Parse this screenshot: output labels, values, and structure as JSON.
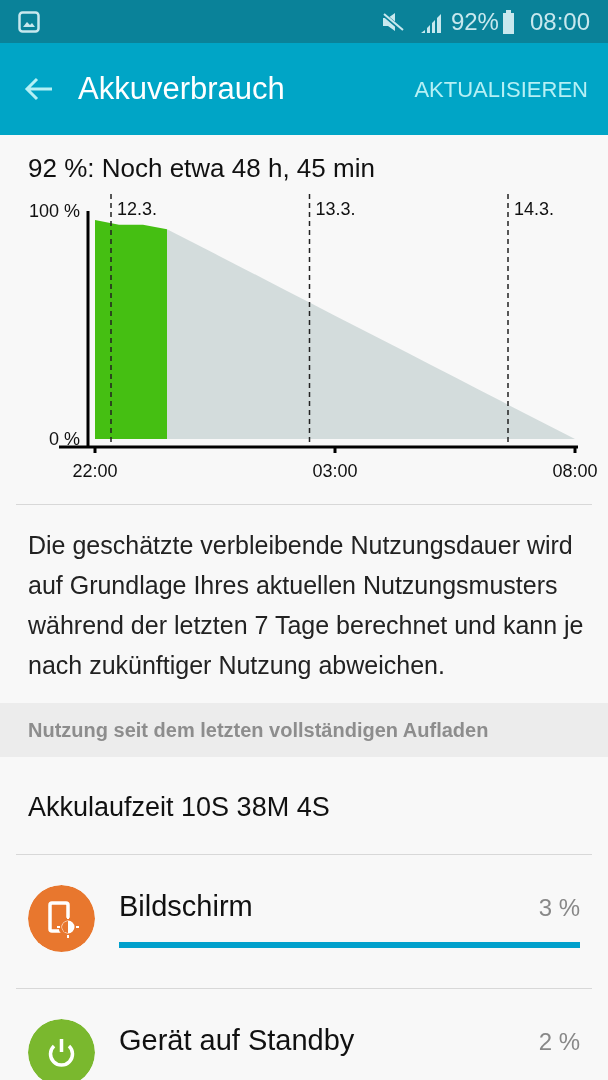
{
  "status_bar": {
    "battery": "92%",
    "time": "08:00"
  },
  "app_bar": {
    "title": "Akkuverbrauch",
    "action": "AKTUALISIEREN"
  },
  "summary": "92 %: Noch etwa 48 h, 45 min",
  "chart_data": {
    "type": "area",
    "categories": [
      "22:00",
      null,
      null,
      null,
      null,
      null,
      null,
      null,
      null,
      null,
      "03:00",
      null,
      null,
      null,
      null,
      null,
      null,
      null,
      null,
      null,
      "08:00"
    ],
    "series": [
      {
        "color": "#45bf12",
        "values": [
          96,
          94,
          94,
          92,
          null,
          null,
          null,
          null,
          null,
          null,
          null,
          null,
          null,
          null,
          null,
          null,
          null,
          null,
          null,
          null,
          null
        ]
      },
      {
        "color": "#d3dcdc",
        "values": [
          null,
          null,
          null,
          92,
          86.6,
          81.2,
          75.8,
          70.4,
          64.9,
          59.5,
          54.1,
          48.7,
          43.3,
          37.9,
          32.5,
          27.1,
          21.6,
          16.2,
          10.8,
          5.4,
          0
        ]
      }
    ],
    "ylim": [
      0,
      100
    ],
    "yticks": [
      {
        "value": 0,
        "label": "0 %"
      },
      {
        "value": 100,
        "label": "100 %"
      }
    ],
    "annotations": [
      "12.3.",
      "13.3.",
      "14.3."
    ]
  },
  "description": "Die geschätzte verbleibende Nutzungsdauer wird auf Grundlage Ihres aktuellen Nutzungsmusters während der letzten 7 Tage berechnet und kann je nach zukünftiger Nutzung abweichen.",
  "section_header": "Nutzung seit dem letzten vollständigen Aufladen",
  "uptime": "Akkulaufzeit 10S 38M 4S",
  "items": [
    {
      "kind": "screen",
      "color": "#e8772e",
      "name": "Bildschirm",
      "percent": "3 %",
      "level": 1
    },
    {
      "kind": "standby",
      "color": "#7ab82e",
      "name": "Gerät auf Standby",
      "percent": "2 %"
    }
  ]
}
